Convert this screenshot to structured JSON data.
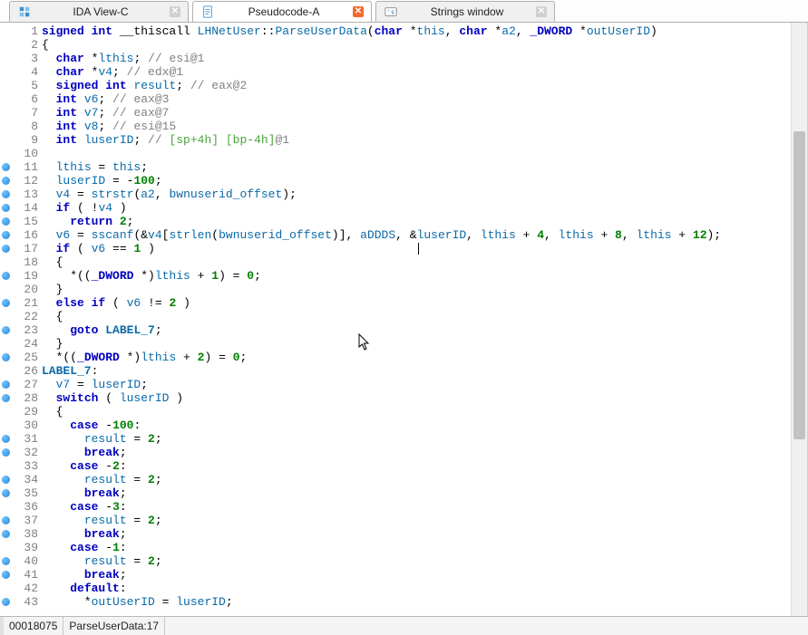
{
  "tabs": [
    {
      "label": "IDA View-C",
      "active": false,
      "close_style": "grey",
      "icon": "blocks"
    },
    {
      "label": "Pseudocode-A",
      "active": true,
      "close_style": "orange",
      "icon": "doc"
    },
    {
      "label": "Strings window",
      "active": false,
      "close_style": "grey",
      "icon": "strings"
    }
  ],
  "status": {
    "address": "00018075",
    "loc": "ParseUserData:17"
  },
  "code": [
    {
      "n": 1,
      "dot": false,
      "tokens": [
        [
          "ty",
          "signed int"
        ],
        [
          "plain",
          " __thiscall "
        ],
        [
          "fn",
          "LHNetUser"
        ],
        [
          "op",
          "::"
        ],
        [
          "fn",
          "ParseUserData"
        ],
        [
          "op",
          "("
        ],
        [
          "ty",
          "char"
        ],
        [
          "plain",
          " *"
        ],
        [
          "id",
          "this"
        ],
        [
          "op",
          ", "
        ],
        [
          "ty",
          "char"
        ],
        [
          "plain",
          " *"
        ],
        [
          "id",
          "a2"
        ],
        [
          "op",
          ", "
        ],
        [
          "ty",
          "_DWORD"
        ],
        [
          "plain",
          " *"
        ],
        [
          "id",
          "outUserID"
        ],
        [
          "op",
          ")"
        ]
      ]
    },
    {
      "n": 2,
      "dot": false,
      "tokens": [
        [
          "op",
          "{"
        ]
      ]
    },
    {
      "n": 3,
      "dot": false,
      "tokens": [
        [
          "plain",
          "  "
        ],
        [
          "ty",
          "char"
        ],
        [
          "plain",
          " *"
        ],
        [
          "id",
          "lthis"
        ],
        [
          "op",
          "; "
        ],
        [
          "cm",
          "// esi@1"
        ]
      ]
    },
    {
      "n": 4,
      "dot": false,
      "tokens": [
        [
          "plain",
          "  "
        ],
        [
          "ty",
          "char"
        ],
        [
          "plain",
          " *"
        ],
        [
          "id",
          "v4"
        ],
        [
          "op",
          "; "
        ],
        [
          "cm",
          "// edx@1"
        ]
      ]
    },
    {
      "n": 5,
      "dot": false,
      "tokens": [
        [
          "plain",
          "  "
        ],
        [
          "ty",
          "signed int"
        ],
        [
          "plain",
          " "
        ],
        [
          "id",
          "result"
        ],
        [
          "op",
          "; "
        ],
        [
          "cm",
          "// eax@2"
        ]
      ]
    },
    {
      "n": 6,
      "dot": false,
      "tokens": [
        [
          "plain",
          "  "
        ],
        [
          "ty",
          "int"
        ],
        [
          "plain",
          " "
        ],
        [
          "id",
          "v6"
        ],
        [
          "op",
          "; "
        ],
        [
          "cm",
          "// eax@3"
        ]
      ]
    },
    {
      "n": 7,
      "dot": false,
      "tokens": [
        [
          "plain",
          "  "
        ],
        [
          "ty",
          "int"
        ],
        [
          "plain",
          " "
        ],
        [
          "id",
          "v7"
        ],
        [
          "op",
          "; "
        ],
        [
          "cm",
          "// eax@7"
        ]
      ]
    },
    {
      "n": 8,
      "dot": false,
      "tokens": [
        [
          "plain",
          "  "
        ],
        [
          "ty",
          "int"
        ],
        [
          "plain",
          " "
        ],
        [
          "id",
          "v8"
        ],
        [
          "op",
          "; "
        ],
        [
          "cm",
          "// esi@15"
        ]
      ]
    },
    {
      "n": 9,
      "dot": false,
      "tokens": [
        [
          "plain",
          "  "
        ],
        [
          "ty",
          "int"
        ],
        [
          "plain",
          " "
        ],
        [
          "id",
          "luserID"
        ],
        [
          "op",
          "; "
        ],
        [
          "cm",
          "// "
        ],
        [
          "cmhint",
          "[sp+4h] [bp-4h]"
        ],
        [
          "cm",
          "@1"
        ]
      ]
    },
    {
      "n": 10,
      "dot": false,
      "tokens": []
    },
    {
      "n": 11,
      "dot": true,
      "tokens": [
        [
          "plain",
          "  "
        ],
        [
          "id",
          "lthis"
        ],
        [
          "op",
          " = "
        ],
        [
          "id",
          "this"
        ],
        [
          "op",
          ";"
        ]
      ]
    },
    {
      "n": 12,
      "dot": true,
      "tokens": [
        [
          "plain",
          "  "
        ],
        [
          "id",
          "luserID"
        ],
        [
          "op",
          " = "
        ],
        [
          "op",
          "-"
        ],
        [
          "num",
          "100"
        ],
        [
          "op",
          ";"
        ]
      ]
    },
    {
      "n": 13,
      "dot": true,
      "tokens": [
        [
          "plain",
          "  "
        ],
        [
          "id",
          "v4"
        ],
        [
          "op",
          " = "
        ],
        [
          "fn",
          "strstr"
        ],
        [
          "op",
          "("
        ],
        [
          "id",
          "a2"
        ],
        [
          "op",
          ", "
        ],
        [
          "id",
          "bwnuserid_offset"
        ],
        [
          "op",
          ");"
        ]
      ]
    },
    {
      "n": 14,
      "dot": true,
      "tokens": [
        [
          "plain",
          "  "
        ],
        [
          "kw",
          "if"
        ],
        [
          "op",
          " ( !"
        ],
        [
          "id",
          "v4"
        ],
        [
          "op",
          " )"
        ]
      ]
    },
    {
      "n": 15,
      "dot": true,
      "tokens": [
        [
          "plain",
          "    "
        ],
        [
          "kw",
          "return"
        ],
        [
          "plain",
          " "
        ],
        [
          "num",
          "2"
        ],
        [
          "op",
          ";"
        ]
      ]
    },
    {
      "n": 16,
      "dot": true,
      "tokens": [
        [
          "plain",
          "  "
        ],
        [
          "id",
          "v6"
        ],
        [
          "op",
          " = "
        ],
        [
          "fn",
          "sscanf"
        ],
        [
          "op",
          "(&"
        ],
        [
          "id",
          "v4"
        ],
        [
          "op",
          "["
        ],
        [
          "fn",
          "strlen"
        ],
        [
          "op",
          "("
        ],
        [
          "id",
          "bwnuserid_offset"
        ],
        [
          "op",
          ")], "
        ],
        [
          "id",
          "aDDDS"
        ],
        [
          "op",
          ", &"
        ],
        [
          "id",
          "luserID"
        ],
        [
          "op",
          ", "
        ],
        [
          "id",
          "lthis"
        ],
        [
          "op",
          " + "
        ],
        [
          "num",
          "4"
        ],
        [
          "op",
          ", "
        ],
        [
          "id",
          "lthis"
        ],
        [
          "op",
          " + "
        ],
        [
          "num",
          "8"
        ],
        [
          "op",
          ", "
        ],
        [
          "id",
          "lthis"
        ],
        [
          "op",
          " + "
        ],
        [
          "num",
          "12"
        ],
        [
          "op",
          ");"
        ]
      ]
    },
    {
      "n": 17,
      "dot": true,
      "caret_after": true,
      "tokens": [
        [
          "plain",
          "  "
        ],
        [
          "kw",
          "if"
        ],
        [
          "op",
          " ( "
        ],
        [
          "id",
          "v6"
        ],
        [
          "op",
          " == "
        ],
        [
          "num",
          "1"
        ],
        [
          "op",
          " )"
        ],
        [
          "plain",
          "                                     "
        ]
      ]
    },
    {
      "n": 18,
      "dot": false,
      "tokens": [
        [
          "plain",
          "  "
        ],
        [
          "op",
          "{"
        ]
      ]
    },
    {
      "n": 19,
      "dot": true,
      "tokens": [
        [
          "plain",
          "    *(("
        ],
        [
          "ty",
          "_DWORD"
        ],
        [
          "plain",
          " *)"
        ],
        [
          "id",
          "lthis"
        ],
        [
          "op",
          " + "
        ],
        [
          "num",
          "1"
        ],
        [
          "op",
          ") = "
        ],
        [
          "num",
          "0"
        ],
        [
          "op",
          ";"
        ]
      ]
    },
    {
      "n": 20,
      "dot": false,
      "tokens": [
        [
          "plain",
          "  "
        ],
        [
          "op",
          "}"
        ]
      ]
    },
    {
      "n": 21,
      "dot": true,
      "tokens": [
        [
          "plain",
          "  "
        ],
        [
          "kw",
          "else if"
        ],
        [
          "op",
          " ( "
        ],
        [
          "id",
          "v6"
        ],
        [
          "op",
          " != "
        ],
        [
          "num",
          "2"
        ],
        [
          "op",
          " )"
        ]
      ]
    },
    {
      "n": 22,
      "dot": false,
      "tokens": [
        [
          "plain",
          "  "
        ],
        [
          "op",
          "{"
        ]
      ]
    },
    {
      "n": 23,
      "dot": true,
      "tokens": [
        [
          "plain",
          "    "
        ],
        [
          "kw",
          "goto"
        ],
        [
          "plain",
          " "
        ],
        [
          "lbl",
          "LABEL_7"
        ],
        [
          "op",
          ";"
        ]
      ]
    },
    {
      "n": 24,
      "dot": false,
      "tokens": [
        [
          "plain",
          "  "
        ],
        [
          "op",
          "}"
        ]
      ]
    },
    {
      "n": 25,
      "dot": true,
      "tokens": [
        [
          "plain",
          "  *(("
        ],
        [
          "ty",
          "_DWORD"
        ],
        [
          "plain",
          " *)"
        ],
        [
          "id",
          "lthis"
        ],
        [
          "op",
          " + "
        ],
        [
          "num",
          "2"
        ],
        [
          "op",
          ") = "
        ],
        [
          "num",
          "0"
        ],
        [
          "op",
          ";"
        ]
      ]
    },
    {
      "n": 26,
      "dot": false,
      "tokens": [
        [
          "lbl",
          "LABEL_7"
        ],
        [
          "op",
          ":"
        ]
      ]
    },
    {
      "n": 27,
      "dot": true,
      "tokens": [
        [
          "plain",
          "  "
        ],
        [
          "id",
          "v7"
        ],
        [
          "op",
          " = "
        ],
        [
          "id",
          "luserID"
        ],
        [
          "op",
          ";"
        ]
      ]
    },
    {
      "n": 28,
      "dot": true,
      "tokens": [
        [
          "plain",
          "  "
        ],
        [
          "kw",
          "switch"
        ],
        [
          "op",
          " ( "
        ],
        [
          "id",
          "luserID"
        ],
        [
          "op",
          " )"
        ]
      ]
    },
    {
      "n": 29,
      "dot": false,
      "tokens": [
        [
          "plain",
          "  "
        ],
        [
          "op",
          "{"
        ]
      ]
    },
    {
      "n": 30,
      "dot": false,
      "tokens": [
        [
          "plain",
          "    "
        ],
        [
          "kw",
          "case"
        ],
        [
          "plain",
          " "
        ],
        [
          "op",
          "-"
        ],
        [
          "num",
          "100"
        ],
        [
          "op",
          ":"
        ]
      ]
    },
    {
      "n": 31,
      "dot": true,
      "tokens": [
        [
          "plain",
          "      "
        ],
        [
          "id",
          "result"
        ],
        [
          "op",
          " = "
        ],
        [
          "num",
          "2"
        ],
        [
          "op",
          ";"
        ]
      ]
    },
    {
      "n": 32,
      "dot": true,
      "tokens": [
        [
          "plain",
          "      "
        ],
        [
          "kw",
          "break"
        ],
        [
          "op",
          ";"
        ]
      ]
    },
    {
      "n": 33,
      "dot": false,
      "tokens": [
        [
          "plain",
          "    "
        ],
        [
          "kw",
          "case"
        ],
        [
          "plain",
          " "
        ],
        [
          "op",
          "-"
        ],
        [
          "num",
          "2"
        ],
        [
          "op",
          ":"
        ]
      ]
    },
    {
      "n": 34,
      "dot": true,
      "tokens": [
        [
          "plain",
          "      "
        ],
        [
          "id",
          "result"
        ],
        [
          "op",
          " = "
        ],
        [
          "num",
          "2"
        ],
        [
          "op",
          ";"
        ]
      ]
    },
    {
      "n": 35,
      "dot": true,
      "tokens": [
        [
          "plain",
          "      "
        ],
        [
          "kw",
          "break"
        ],
        [
          "op",
          ";"
        ]
      ]
    },
    {
      "n": 36,
      "dot": false,
      "tokens": [
        [
          "plain",
          "    "
        ],
        [
          "kw",
          "case"
        ],
        [
          "plain",
          " "
        ],
        [
          "op",
          "-"
        ],
        [
          "num",
          "3"
        ],
        [
          "op",
          ":"
        ]
      ]
    },
    {
      "n": 37,
      "dot": true,
      "tokens": [
        [
          "plain",
          "      "
        ],
        [
          "id",
          "result"
        ],
        [
          "op",
          " = "
        ],
        [
          "num",
          "2"
        ],
        [
          "op",
          ";"
        ]
      ]
    },
    {
      "n": 38,
      "dot": true,
      "tokens": [
        [
          "plain",
          "      "
        ],
        [
          "kw",
          "break"
        ],
        [
          "op",
          ";"
        ]
      ]
    },
    {
      "n": 39,
      "dot": false,
      "tokens": [
        [
          "plain",
          "    "
        ],
        [
          "kw",
          "case"
        ],
        [
          "plain",
          " "
        ],
        [
          "op",
          "-"
        ],
        [
          "num",
          "1"
        ],
        [
          "op",
          ":"
        ]
      ]
    },
    {
      "n": 40,
      "dot": true,
      "tokens": [
        [
          "plain",
          "      "
        ],
        [
          "id",
          "result"
        ],
        [
          "op",
          " = "
        ],
        [
          "num",
          "2"
        ],
        [
          "op",
          ";"
        ]
      ]
    },
    {
      "n": 41,
      "dot": true,
      "tokens": [
        [
          "plain",
          "      "
        ],
        [
          "kw",
          "break"
        ],
        [
          "op",
          ";"
        ]
      ]
    },
    {
      "n": 42,
      "dot": false,
      "tokens": [
        [
          "plain",
          "    "
        ],
        [
          "kw",
          "default"
        ],
        [
          "op",
          ":"
        ]
      ]
    },
    {
      "n": 43,
      "dot": true,
      "tokens": [
        [
          "plain",
          "      *"
        ],
        [
          "id",
          "outUserID"
        ],
        [
          "op",
          " = "
        ],
        [
          "id",
          "luserID"
        ],
        [
          "op",
          ";"
        ]
      ]
    }
  ]
}
